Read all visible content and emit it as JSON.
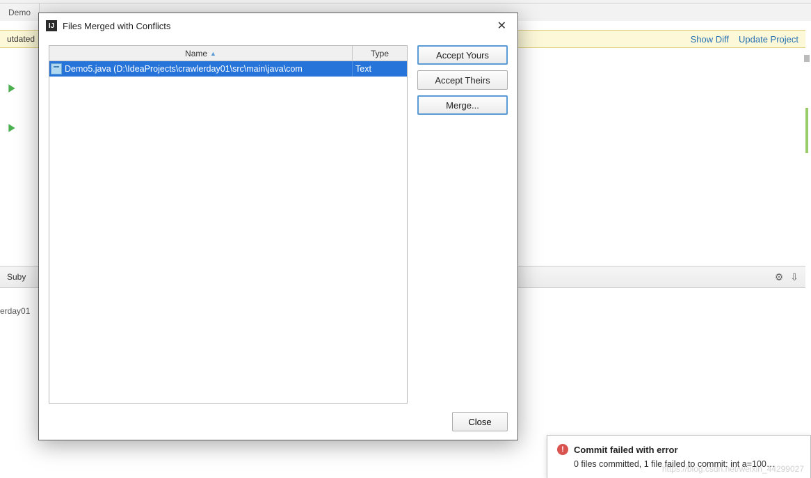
{
  "ide": {
    "tab_demo": "Demo",
    "outdated_label": "utdated",
    "links": {
      "show_diff": "Show Diff",
      "update_project": "Update Project"
    },
    "mid_label": "Suby",
    "lower_path": "erday01",
    "gear_glyph": "⚙",
    "download_glyph": "⇩"
  },
  "dialog": {
    "title": "Files Merged with Conflicts",
    "icon_text": "IJ",
    "columns": {
      "name": "Name",
      "type": "Type",
      "sort_glyph": "▲"
    },
    "row": {
      "name": "Demo5.java (D:\\IdeaProjects\\crawlerday01\\src\\main\\java\\com",
      "type": "Text"
    },
    "buttons": {
      "accept_yours": "Accept Yours",
      "accept_theirs": "Accept Theirs",
      "merge": "Merge...",
      "close": "Close"
    },
    "close_x": "✕"
  },
  "toast": {
    "title": "Commit failed with error",
    "body": "0 files committed, 1 file failed to commit: int a=100…",
    "err_glyph": "!"
  },
  "watermark": "https://blog.csdn.net/weixin_44299027"
}
